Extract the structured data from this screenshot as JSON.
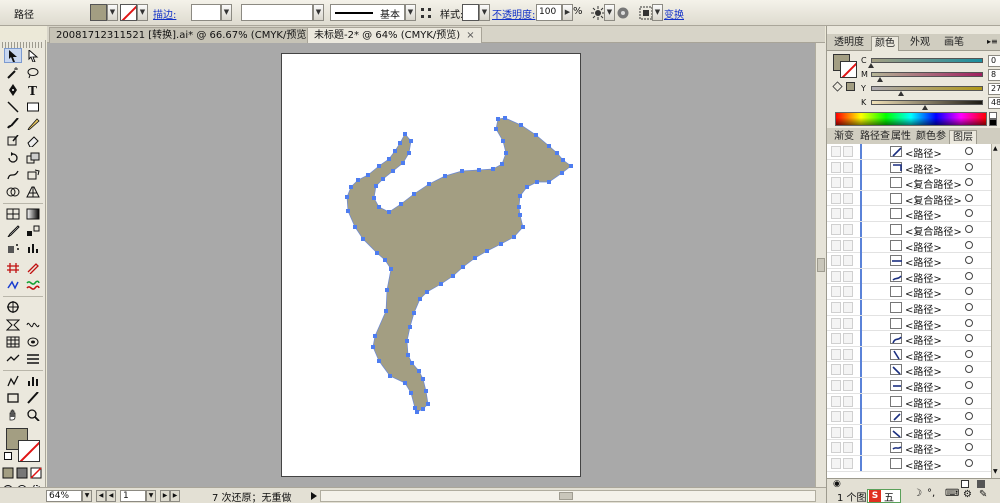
{
  "control_bar": {
    "object_type": "路径",
    "fill_color": "#a39e82",
    "stroke_label": "描边:",
    "stroke_style_label": "基本",
    "style_label": "样式:",
    "opacity_label": "不透明度:",
    "opacity_value": "100",
    "opacity_unit": "%",
    "transform_label": "变换"
  },
  "tabs": [
    {
      "label": "20081712311521 [转换].ai* @ 66.67% (CMYK/预览)",
      "active": false
    },
    {
      "label": "未标题-2* @ 64% (CMYK/预览)",
      "active": true
    }
  ],
  "status": {
    "zoom": "64%",
    "artboard": "1",
    "message": "7 次还原；无重做"
  },
  "color_panel": {
    "tabs": [
      "透明度",
      "颜色",
      "外观",
      "画笔"
    ],
    "active_tab": "颜色",
    "fill_color": "#a39e82",
    "channels": [
      {
        "name": "C",
        "value": "0",
        "pos": 0
      },
      {
        "name": "M",
        "value": "8",
        "pos": 8
      },
      {
        "name": "Y",
        "value": "27",
        "pos": 27
      },
      {
        "name": "K",
        "value": "48",
        "pos": 48
      }
    ],
    "unit": "%"
  },
  "layers_panel": {
    "tabs": [
      "渐变",
      "路径查",
      "属性",
      "颜色参",
      "图层"
    ],
    "active_tab": "图层",
    "items": [
      {
        "name": "<路径>"
      },
      {
        "name": "<路径>"
      },
      {
        "name": "<复合路径>"
      },
      {
        "name": "<复合路径>"
      },
      {
        "name": "<路径>"
      },
      {
        "name": "<复合路径>"
      },
      {
        "name": "<路径>"
      },
      {
        "name": "<路径>"
      },
      {
        "name": "<路径>"
      },
      {
        "name": "<路径>"
      },
      {
        "name": "<路径>"
      },
      {
        "name": "<路径>"
      },
      {
        "name": "<路径>"
      },
      {
        "name": "<路径>"
      },
      {
        "name": "<路径>"
      },
      {
        "name": "<路径>"
      },
      {
        "name": "<路径>"
      },
      {
        "name": "<路径>"
      },
      {
        "name": "<路径>"
      },
      {
        "name": "<路径>"
      },
      {
        "name": "<路径>"
      }
    ],
    "footer_label": "1 个图层"
  },
  "ime_bar": "五"
}
